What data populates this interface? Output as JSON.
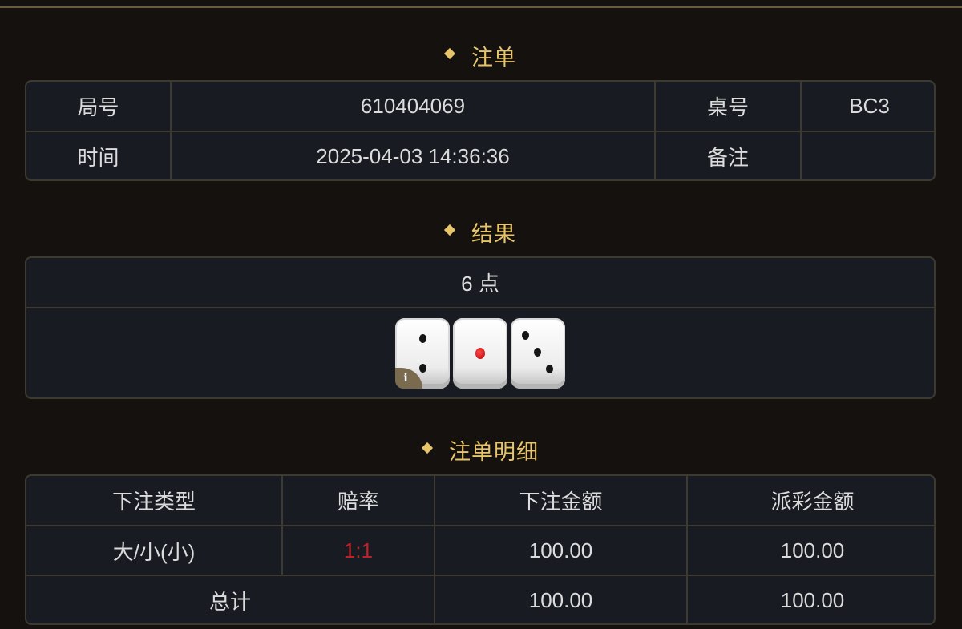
{
  "sections": {
    "bet": "注单",
    "result": "结果",
    "detail": "注单明细"
  },
  "bet_info": {
    "round_label": "局号",
    "round_value": "610404069",
    "table_label": "桌号",
    "table_value": "BC3",
    "time_label": "时间",
    "time_value": "2025-04-03 14:36:36",
    "remark_label": "备注",
    "remark_value": ""
  },
  "result": {
    "points": "6 点",
    "dice": [
      2,
      1,
      3
    ],
    "info_icon": "i"
  },
  "detail": {
    "headers": [
      "下注类型",
      "赔率",
      "下注金额",
      "派彩金额"
    ],
    "rows": [
      [
        "大/小(小)",
        "1:1",
        "100.00",
        "100.00"
      ]
    ],
    "total_label": "总计",
    "total_bet": "100.00",
    "total_payout": "100.00"
  },
  "colors": {
    "accent": "#e8c56a",
    "odds": "#c0202a",
    "background": "#14110e",
    "panel": "#181b22"
  }
}
